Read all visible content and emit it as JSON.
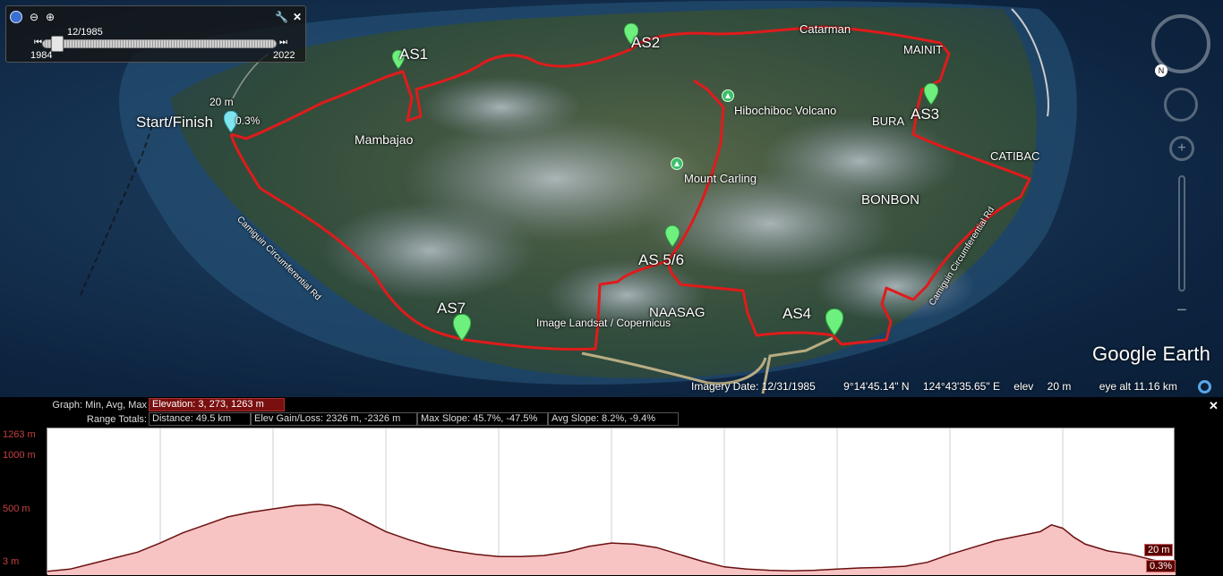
{
  "timeslider": {
    "current": "12/1985",
    "start": "1984",
    "end": "2022",
    "current_fraction": 0.04
  },
  "map": {
    "places": [
      {
        "id": "start",
        "text": "Start/Finish"
      },
      {
        "id": "mambajao",
        "text": "Mambajao"
      },
      {
        "id": "as1",
        "text": "AS1"
      },
      {
        "id": "as2",
        "text": "AS2"
      },
      {
        "id": "catarman",
        "text": "Catarman"
      },
      {
        "id": "mainit",
        "text": "MAINIT"
      },
      {
        "id": "bura",
        "text": "BURA"
      },
      {
        "id": "as3",
        "text": "AS3"
      },
      {
        "id": "catibac",
        "text": "CATIBAC"
      },
      {
        "id": "bonbon",
        "text": "BONBON"
      },
      {
        "id": "hibochiboc",
        "text": "Hibochiboc Volcano"
      },
      {
        "id": "carling",
        "text": "Mount Carling"
      },
      {
        "id": "as56",
        "text": "AS 5/6"
      },
      {
        "id": "naasag",
        "text": "NAASAG"
      },
      {
        "id": "as4",
        "text": "AS4"
      },
      {
        "id": "as7",
        "text": "AS7"
      },
      {
        "id": "credit",
        "text": "Image Landsat / Copernicus"
      },
      {
        "id": "elev_marker",
        "text": "20 m"
      },
      {
        "id": "slope_marker",
        "text": "0.3%"
      }
    ],
    "road_west": "Camiguin Circumferential Rd",
    "road_east": "Camiguin Circumferential Rd",
    "logo": "Google Earth",
    "status": {
      "imagery_date": "Imagery Date: 12/31/1985",
      "lat": "9°14'45.14\" N",
      "lon": "124°43'35.65\" E",
      "elev_label": "elev",
      "elev_value": "20 m",
      "eye_alt": "eye alt  11.16 km"
    }
  },
  "elevation_panel": {
    "graph_label": "Graph: Min, Avg, Max",
    "elevation_cell": "Elevation: 3, 273, 1263 m",
    "range_label": "Range Totals:",
    "distance": "Distance: 49.5 km",
    "gain_loss": "Elev Gain/Loss: 2326 m, -2326 m",
    "max_slope": "Max Slope: 45.7%, -47.5%",
    "avg_slope": "Avg Slope: 8.2%, -9.4%",
    "end_elev": "20 m",
    "end_slope": "0.3%"
  },
  "chart_data": {
    "type": "area",
    "ylim": [
      3,
      1263
    ],
    "yticks": [
      "1263 m",
      "1000 m",
      "500 m",
      "3 m"
    ],
    "ytick_values": [
      1263,
      1000,
      500,
      3
    ],
    "x_vertical_gridlines": 10,
    "x": [
      0,
      0.02,
      0.04,
      0.06,
      0.08,
      0.1,
      0.12,
      0.14,
      0.16,
      0.18,
      0.2,
      0.22,
      0.24,
      0.25,
      0.26,
      0.28,
      0.3,
      0.32,
      0.34,
      0.36,
      0.38,
      0.4,
      0.42,
      0.44,
      0.46,
      0.48,
      0.5,
      0.52,
      0.54,
      0.56,
      0.58,
      0.6,
      0.62,
      0.64,
      0.66,
      0.68,
      0.7,
      0.72,
      0.74,
      0.76,
      0.78,
      0.8,
      0.82,
      0.84,
      0.86,
      0.88,
      0.89,
      0.9,
      0.91,
      0.92,
      0.94,
      0.96,
      0.98,
      1.0
    ],
    "y": [
      20,
      40,
      90,
      140,
      190,
      270,
      360,
      430,
      500,
      540,
      570,
      600,
      610,
      600,
      570,
      470,
      370,
      300,
      240,
      200,
      170,
      150,
      150,
      160,
      190,
      240,
      270,
      260,
      230,
      170,
      110,
      60,
      40,
      30,
      25,
      30,
      40,
      50,
      55,
      65,
      100,
      170,
      230,
      290,
      330,
      370,
      430,
      400,
      320,
      260,
      200,
      170,
      120,
      80
    ]
  }
}
